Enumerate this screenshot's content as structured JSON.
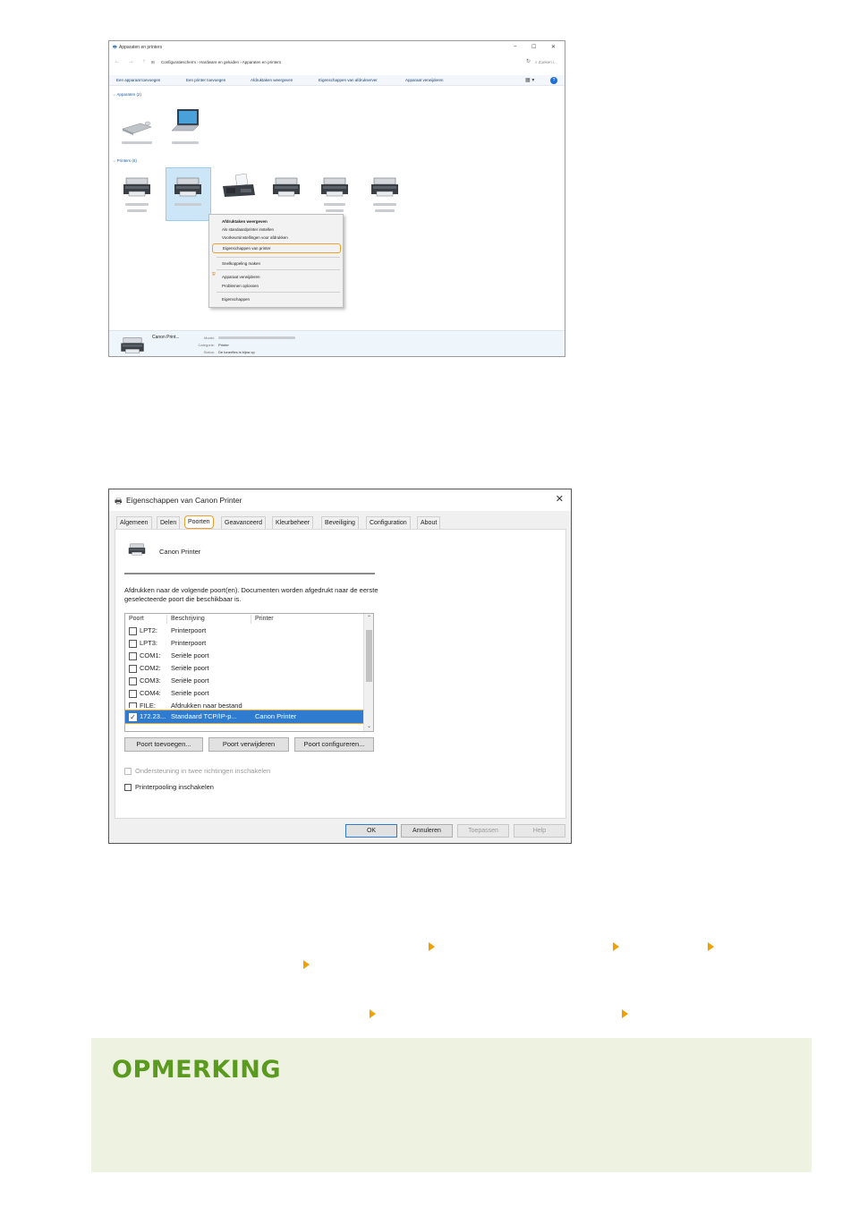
{
  "screenshot1": {
    "title": "Apparaten en printers",
    "window_controls": [
      "–",
      "☐",
      "✕"
    ],
    "nav_arrows": "← → ↑",
    "address_path": "Configuratiescherm  ›  Hardware en geluiden  ›  Apparaten en printers",
    "search_placeholder": "Zoeken i...",
    "commands": [
      "Een apparaat toevoegen",
      "Een printer toevoegen",
      "Afdruktaken weergeven",
      "Eigenschappen van afdrukserver",
      "Apparaat verwijderen"
    ],
    "section_devices": "Apparaten (2)",
    "section_printers": "Printers (6)",
    "context_menu": [
      {
        "label": "Afdruktaken weergeven",
        "bold": true
      },
      {
        "label": "Als standaardprinter instellen"
      },
      {
        "label": "Voorkeursinstellingen voor afdrukken"
      },
      {
        "label": "Eigenschappen van printer",
        "highlighted": true
      },
      {
        "label": "Snelkoppeling maken"
      },
      {
        "label": "Apparaat verwijderen",
        "shield": true
      },
      {
        "label": "Problemen oplossen"
      },
      {
        "label": "Eigenschappen"
      }
    ],
    "details": {
      "name": "Canon Print...",
      "model_label": "Model:",
      "category_label": "Categorie:",
      "category_value": "Printer",
      "status_label": "Status:",
      "status_value": "De tonerfles is bijna op"
    }
  },
  "screenshot2": {
    "title": "Eigenschappen van Canon Printer",
    "close": "✕",
    "tabs": [
      "Algemeen",
      "Delen",
      "Poorten",
      "Geavanceerd",
      "Kleurbeheer",
      "Beveiliging",
      "Configuration",
      "About"
    ],
    "active_tab": "Poorten",
    "printer_name": "Canon Printer",
    "description": "Afdrukken naar de volgende poort(en). Documenten worden afgedrukt naar de eerste geselecteerde poort die beschikbaar is.",
    "columns": [
      "Poort",
      "Beschrijving",
      "Printer"
    ],
    "ports": [
      {
        "port": "LPT2:",
        "desc": "Printerpoort",
        "printer": "",
        "checked": false
      },
      {
        "port": "LPT3:",
        "desc": "Printerpoort",
        "printer": "",
        "checked": false
      },
      {
        "port": "COM1:",
        "desc": "Seriële poort",
        "printer": "",
        "checked": false
      },
      {
        "port": "COM2:",
        "desc": "Seriële poort",
        "printer": "",
        "checked": false
      },
      {
        "port": "COM3:",
        "desc": "Seriële poort",
        "printer": "",
        "checked": false
      },
      {
        "port": "COM4:",
        "desc": "Seriële poort",
        "printer": "",
        "checked": false
      },
      {
        "port": "FILE:",
        "desc": "Afdrukken naar bestand",
        "printer": "",
        "checked": false
      },
      {
        "port": "172.23...",
        "desc": "Standaard TCP/IP-p...",
        "printer": "Canon Printer",
        "checked": true
      }
    ],
    "buttons": [
      "Poort toevoegen...",
      "Poort verwijderen",
      "Poort configureren..."
    ],
    "checkbox_bidir": "Ondersteuning in twee richtingen inschakelen",
    "checkbox_pool": "Printerpooling inschakelen",
    "footer_buttons": [
      "OK",
      "Annuleren",
      "Toepassen",
      "Help"
    ]
  },
  "note": {
    "title": "OPMERKING"
  },
  "colors": {
    "highlight": "#f0a030",
    "note_bg": "#eef3e1",
    "note_title": "#5a9a1e",
    "arrow": "#f0a000"
  }
}
